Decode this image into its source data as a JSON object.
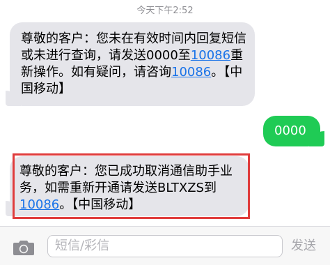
{
  "header": {
    "timestamp": "今天下午2:52"
  },
  "messages": [
    {
      "direction": "incoming",
      "parts": [
        "尊敬的客户：您未在有效时间内回复短信或未进行查询，请发送0000至",
        "10086",
        "重新操作。如有疑问，请咨询",
        "10086",
        "。【中国移动】"
      ]
    },
    {
      "direction": "outgoing",
      "text": "0000"
    },
    {
      "direction": "incoming",
      "parts": [
        "尊敬的客户：您已成功取消通信助手业务，如需重新开通请发送BLTXZS到",
        "10086",
        "。【中国移动】"
      ],
      "highlighted": true
    }
  ],
  "composer": {
    "placeholder": "短信/彩信",
    "send_label": "发送",
    "camera_icon": "camera-icon"
  },
  "colors": {
    "incoming_bubble": "#e5e5ea",
    "outgoing_bubble": "#1fcb55",
    "link": "#1a73e8",
    "highlight": "#e03c3c"
  }
}
